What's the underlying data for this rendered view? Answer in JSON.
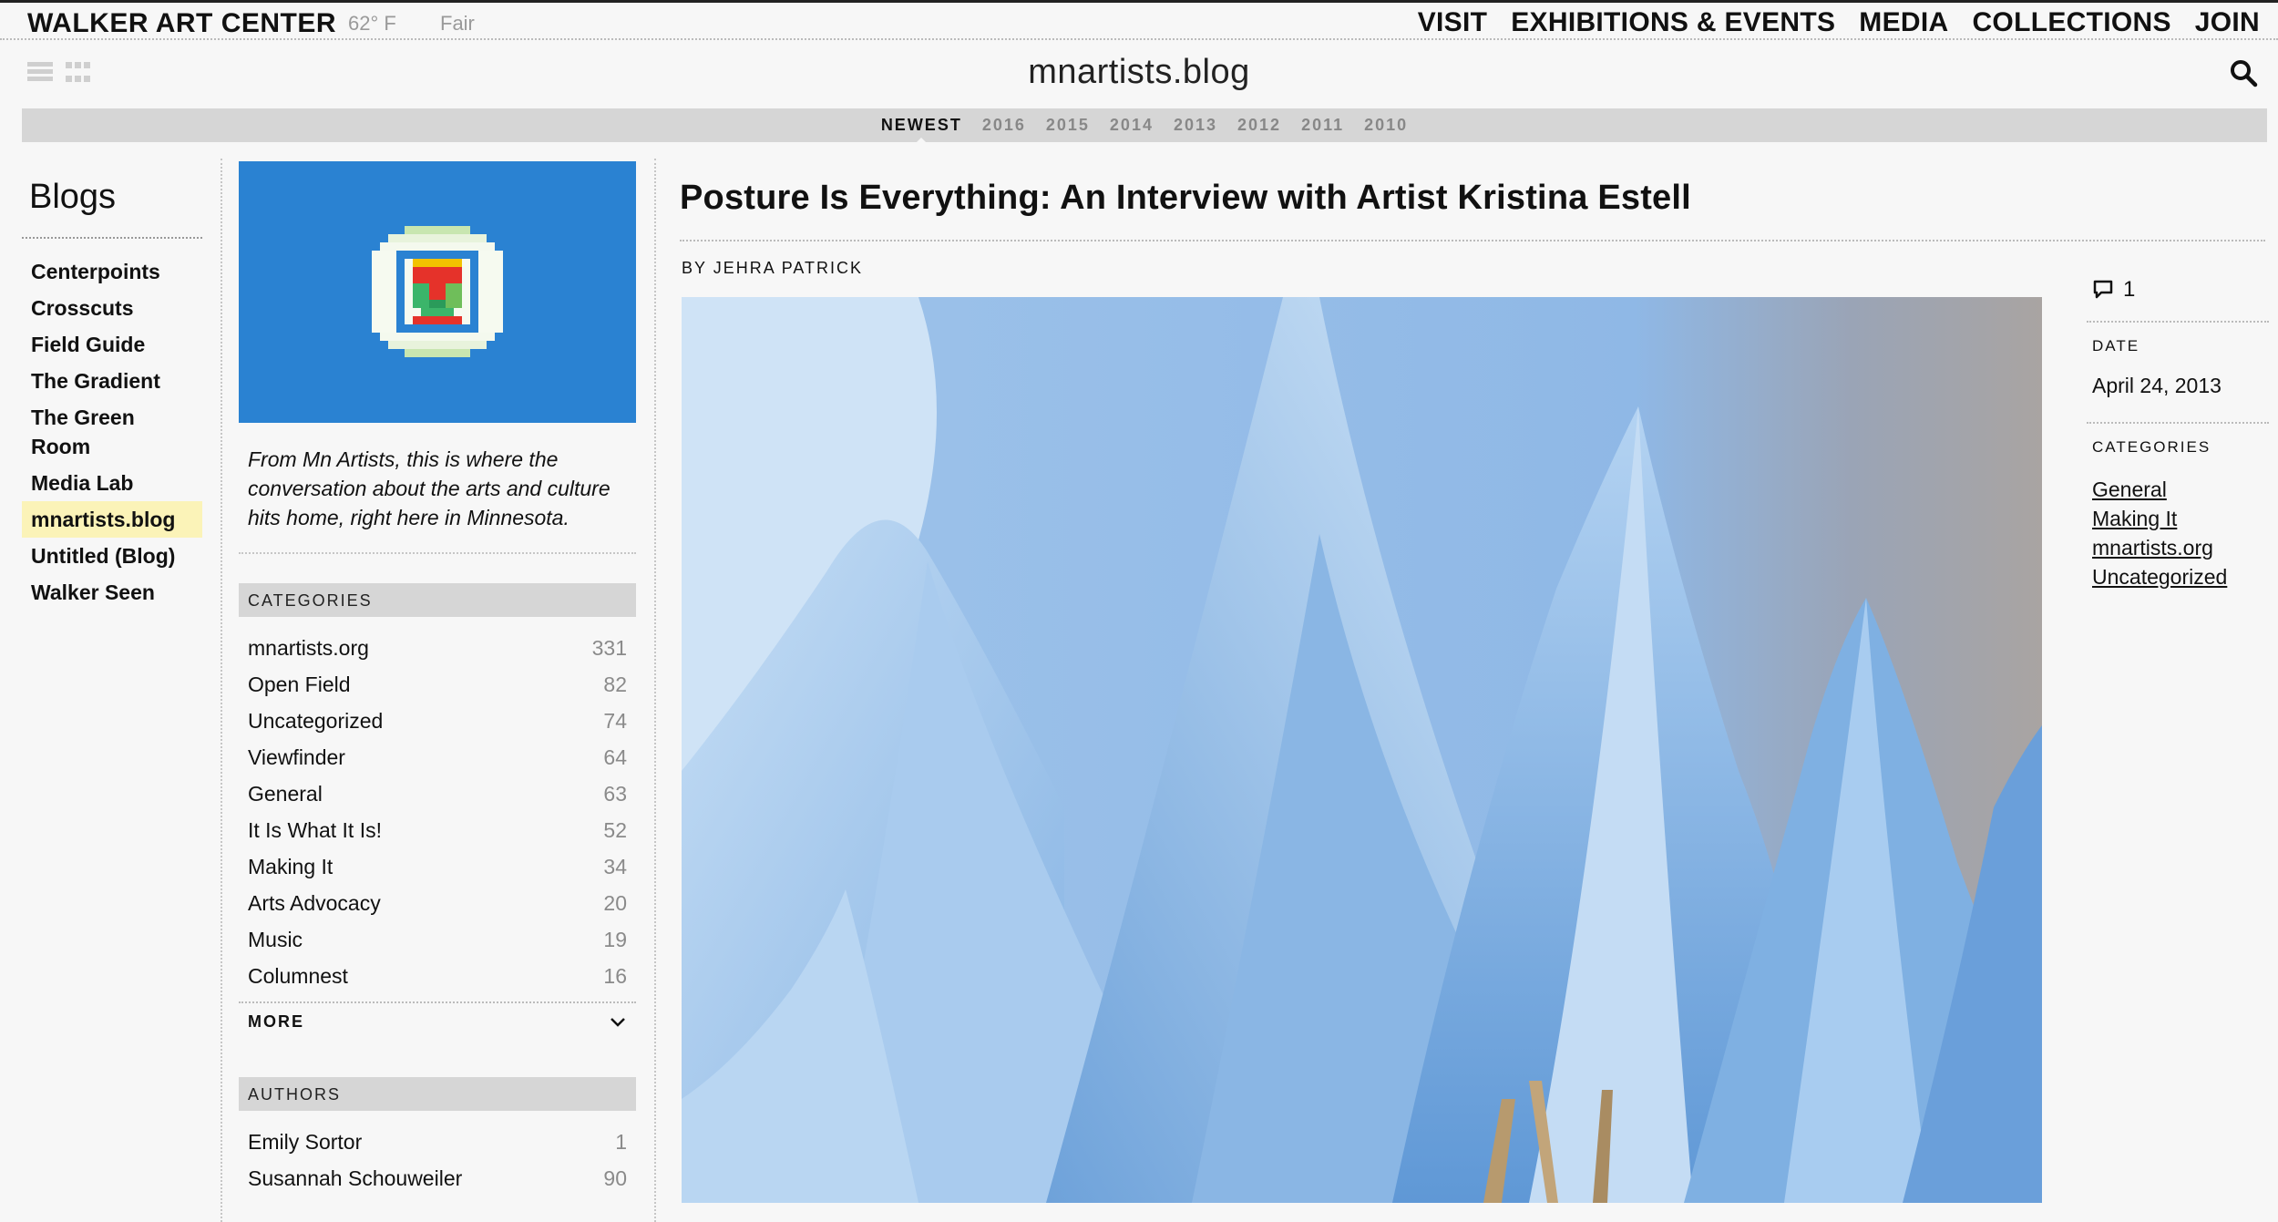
{
  "topbar": {
    "brand": "WALKER ART CENTER",
    "temperature": "62° F",
    "condition": "Fair",
    "nav": [
      "VISIT",
      "EXHIBITIONS & EVENTS",
      "MEDIA",
      "COLLECTIONS",
      "JOIN"
    ]
  },
  "header": {
    "blog_title": "mnartists.blog"
  },
  "years": [
    "NEWEST",
    "2016",
    "2015",
    "2014",
    "2013",
    "2012",
    "2011",
    "2010"
  ],
  "blogs": {
    "heading": "Blogs",
    "items": [
      "Centerpoints",
      "Crosscuts",
      "Field Guide",
      "The Gradient",
      "The Green Room",
      "Media Lab",
      "mnartists.blog",
      "Untitled (Blog)",
      "Walker Seen"
    ],
    "active": "mnartists.blog"
  },
  "info": {
    "tagline": "From Mn Artists, this is where the conversation about the arts and culture hits home, right here in Minnesota.",
    "categories_heading": "CATEGORIES",
    "categories": [
      {
        "name": "mnartists.org",
        "count": "331"
      },
      {
        "name": "Open Field",
        "count": "82"
      },
      {
        "name": "Uncategorized",
        "count": "74"
      },
      {
        "name": "Viewfinder",
        "count": "64"
      },
      {
        "name": "General",
        "count": "63"
      },
      {
        "name": "It Is What It Is!",
        "count": "52"
      },
      {
        "name": "Making It",
        "count": "34"
      },
      {
        "name": "Arts Advocacy",
        "count": "20"
      },
      {
        "name": "Music",
        "count": "19"
      },
      {
        "name": "Columnest",
        "count": "16"
      }
    ],
    "more_label": "MORE",
    "authors_heading": "AUTHORS",
    "authors": [
      {
        "name": "Emily Sortor",
        "count": "1"
      },
      {
        "name": "Susannah Schouweiler",
        "count": "90"
      }
    ]
  },
  "article": {
    "title": "Posture Is Everything: An Interview with Artist Kristina Estell",
    "byline": "BY JEHRA PATRICK"
  },
  "meta": {
    "comment_count": "1",
    "date_label": "DATE",
    "date": "April 24, 2013",
    "categories_label": "CATEGORIES",
    "categories": [
      "General",
      "Making It",
      "mnartists.org",
      "Uncategorized"
    ]
  }
}
